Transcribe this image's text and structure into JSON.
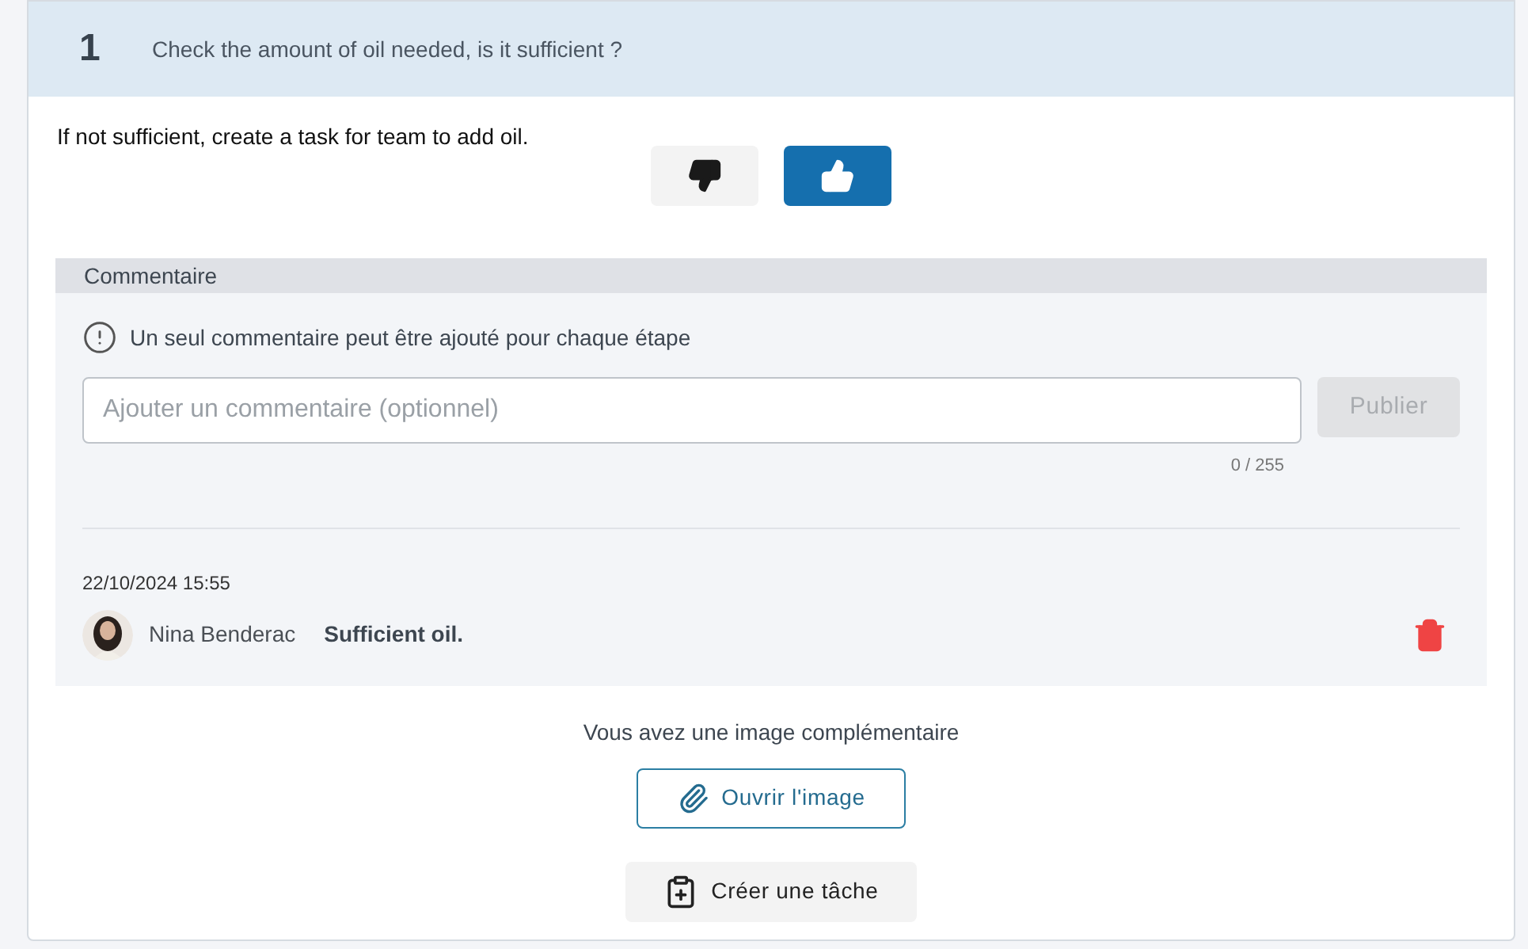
{
  "step": {
    "number": "1",
    "question": "Check the amount of oil needed, is it sufficient ?"
  },
  "description": "If not sufficient, create a task for team to add oil.",
  "votes": [
    {
      "kind": "down",
      "selected": false
    },
    {
      "kind": "up",
      "selected": true
    }
  ],
  "comments": {
    "title": "Commentaire",
    "notice": "Un seul commentaire peut être ajouté pour chaque étape",
    "input": {
      "placeholder": "Ajouter un commentaire (optionnel)"
    },
    "publish": {
      "label": "Publier",
      "disabled": true
    },
    "counter": "0 / 255",
    "entries": [
      {
        "date": "22/10/2024 15:55",
        "author": "Nina Benderac",
        "text": "Sufficient oil."
      }
    ]
  },
  "attachment_note": "Vous avez une image complémentaire",
  "open_image": "Ouvrir l'image",
  "create_task": "Créer une tâche"
}
